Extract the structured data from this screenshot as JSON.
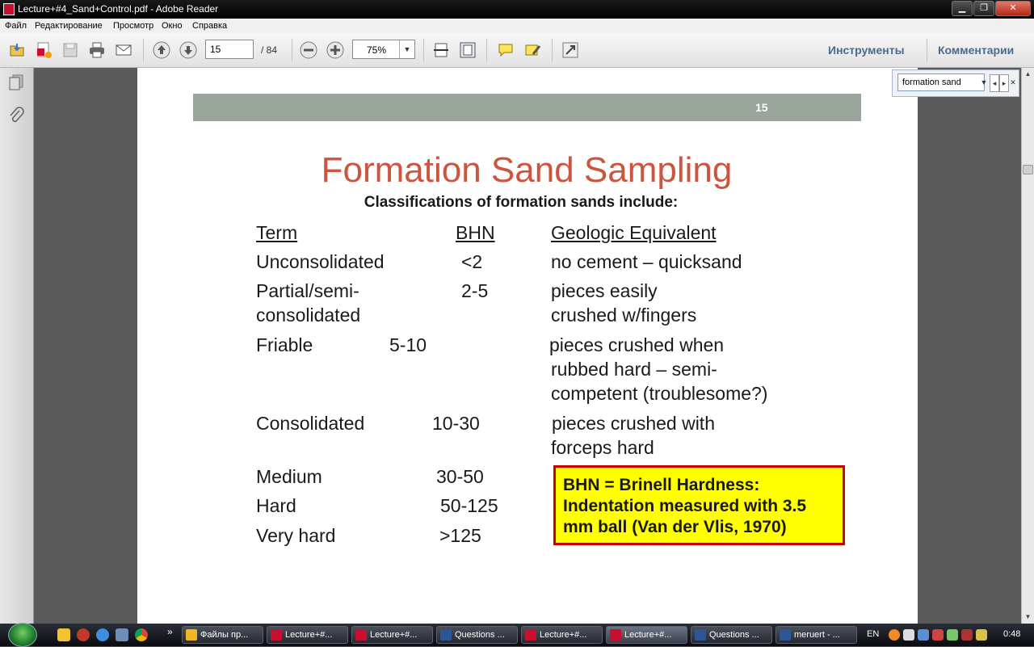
{
  "window": {
    "title": "Lecture+#4_Sand+Control.pdf - Adobe Reader",
    "minimize": "▁",
    "maximize": "❐",
    "close": "✕"
  },
  "menu": [
    "Файл",
    "Редактирование",
    "Просмотр",
    "Окно",
    "Справка"
  ],
  "toolbar": {
    "page_current": "15",
    "page_total": "/ 84",
    "zoom": "75%",
    "tools_label": "Инструменты",
    "comments_label": "Комментарии"
  },
  "find": {
    "value": "formation sand"
  },
  "slide": {
    "number": "15",
    "title": "Formation Sand Sampling",
    "subtitle": "Classifications of formation sands include:",
    "headers": {
      "term": "Term",
      "bhn": "BHN",
      "geo": "Geologic Equivalent"
    },
    "rows": [
      {
        "term": "Unconsolidated",
        "bhn": "<2",
        "geo": "no cement – quicksand"
      },
      {
        "term": "Partial/semi-",
        "term2": "consolidated",
        "bhn": "2-5",
        "geo": "pieces easily",
        "geo2": "crushed w/fingers"
      },
      {
        "term": "Friable",
        "bhn": "5-10",
        "geo": "pieces crushed when",
        "geo2": "rubbed hard – semi-",
        "geo3": "competent (troublesome?)"
      },
      {
        "term": "Consolidated",
        "bhn": "10-30",
        "geo": "pieces crushed with",
        "geo2": "forceps hard"
      },
      {
        "term": "Medium",
        "bhn": "30-50"
      },
      {
        "term": "Hard",
        "bhn": "50-125"
      },
      {
        "term": "Very hard",
        "bhn": ">125"
      }
    ],
    "note": {
      "line1": "BHN = Brinell Hardness:",
      "line2": "Indentation measured with 3.5",
      "line3": "mm ball (Van der Vlis, 1970)"
    }
  },
  "taskbar": {
    "quicklaunch_overflow": "»",
    "tasks": [
      {
        "label": "Файлы пр...",
        "color": "#f2b622"
      },
      {
        "label": "Lecture+#...",
        "color": "#c8102e"
      },
      {
        "label": "Lecture+#...",
        "color": "#c8102e"
      },
      {
        "label": "Questions ...",
        "color": "#2b5797"
      },
      {
        "label": "Lecture+#...",
        "color": "#c8102e"
      },
      {
        "label": "Lecture+#...",
        "color": "#c8102e"
      },
      {
        "label": "Questions ...",
        "color": "#2b5797"
      },
      {
        "label": "meruert - ...",
        "color": "#2b5797"
      }
    ],
    "language": "EN",
    "clock": "0:48"
  },
  "colors": {
    "title_red": "#cc5540",
    "slide_bar": "#9aa59b",
    "note_yellow": "#ffff00",
    "note_border": "#cc0000"
  }
}
